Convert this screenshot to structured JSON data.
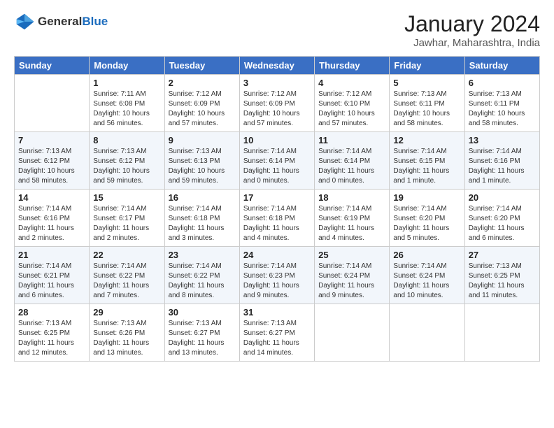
{
  "header": {
    "logo_general": "General",
    "logo_blue": "Blue",
    "month": "January 2024",
    "location": "Jawhar, Maharashtra, India"
  },
  "days_of_week": [
    "Sunday",
    "Monday",
    "Tuesday",
    "Wednesday",
    "Thursday",
    "Friday",
    "Saturday"
  ],
  "weeks": [
    [
      {
        "day": "",
        "info": ""
      },
      {
        "day": "1",
        "info": "Sunrise: 7:11 AM\nSunset: 6:08 PM\nDaylight: 10 hours\nand 56 minutes."
      },
      {
        "day": "2",
        "info": "Sunrise: 7:12 AM\nSunset: 6:09 PM\nDaylight: 10 hours\nand 57 minutes."
      },
      {
        "day": "3",
        "info": "Sunrise: 7:12 AM\nSunset: 6:09 PM\nDaylight: 10 hours\nand 57 minutes."
      },
      {
        "day": "4",
        "info": "Sunrise: 7:12 AM\nSunset: 6:10 PM\nDaylight: 10 hours\nand 57 minutes."
      },
      {
        "day": "5",
        "info": "Sunrise: 7:13 AM\nSunset: 6:11 PM\nDaylight: 10 hours\nand 58 minutes."
      },
      {
        "day": "6",
        "info": "Sunrise: 7:13 AM\nSunset: 6:11 PM\nDaylight: 10 hours\nand 58 minutes."
      }
    ],
    [
      {
        "day": "7",
        "info": "Sunrise: 7:13 AM\nSunset: 6:12 PM\nDaylight: 10 hours\nand 58 minutes."
      },
      {
        "day": "8",
        "info": "Sunrise: 7:13 AM\nSunset: 6:12 PM\nDaylight: 10 hours\nand 59 minutes."
      },
      {
        "day": "9",
        "info": "Sunrise: 7:13 AM\nSunset: 6:13 PM\nDaylight: 10 hours\nand 59 minutes."
      },
      {
        "day": "10",
        "info": "Sunrise: 7:14 AM\nSunset: 6:14 PM\nDaylight: 11 hours\nand 0 minutes."
      },
      {
        "day": "11",
        "info": "Sunrise: 7:14 AM\nSunset: 6:14 PM\nDaylight: 11 hours\nand 0 minutes."
      },
      {
        "day": "12",
        "info": "Sunrise: 7:14 AM\nSunset: 6:15 PM\nDaylight: 11 hours\nand 1 minute."
      },
      {
        "day": "13",
        "info": "Sunrise: 7:14 AM\nSunset: 6:16 PM\nDaylight: 11 hours\nand 1 minute."
      }
    ],
    [
      {
        "day": "14",
        "info": "Sunrise: 7:14 AM\nSunset: 6:16 PM\nDaylight: 11 hours\nand 2 minutes."
      },
      {
        "day": "15",
        "info": "Sunrise: 7:14 AM\nSunset: 6:17 PM\nDaylight: 11 hours\nand 2 minutes."
      },
      {
        "day": "16",
        "info": "Sunrise: 7:14 AM\nSunset: 6:18 PM\nDaylight: 11 hours\nand 3 minutes."
      },
      {
        "day": "17",
        "info": "Sunrise: 7:14 AM\nSunset: 6:18 PM\nDaylight: 11 hours\nand 4 minutes."
      },
      {
        "day": "18",
        "info": "Sunrise: 7:14 AM\nSunset: 6:19 PM\nDaylight: 11 hours\nand 4 minutes."
      },
      {
        "day": "19",
        "info": "Sunrise: 7:14 AM\nSunset: 6:20 PM\nDaylight: 11 hours\nand 5 minutes."
      },
      {
        "day": "20",
        "info": "Sunrise: 7:14 AM\nSunset: 6:20 PM\nDaylight: 11 hours\nand 6 minutes."
      }
    ],
    [
      {
        "day": "21",
        "info": "Sunrise: 7:14 AM\nSunset: 6:21 PM\nDaylight: 11 hours\nand 6 minutes."
      },
      {
        "day": "22",
        "info": "Sunrise: 7:14 AM\nSunset: 6:22 PM\nDaylight: 11 hours\nand 7 minutes."
      },
      {
        "day": "23",
        "info": "Sunrise: 7:14 AM\nSunset: 6:22 PM\nDaylight: 11 hours\nand 8 minutes."
      },
      {
        "day": "24",
        "info": "Sunrise: 7:14 AM\nSunset: 6:23 PM\nDaylight: 11 hours\nand 9 minutes."
      },
      {
        "day": "25",
        "info": "Sunrise: 7:14 AM\nSunset: 6:24 PM\nDaylight: 11 hours\nand 9 minutes."
      },
      {
        "day": "26",
        "info": "Sunrise: 7:14 AM\nSunset: 6:24 PM\nDaylight: 11 hours\nand 10 minutes."
      },
      {
        "day": "27",
        "info": "Sunrise: 7:13 AM\nSunset: 6:25 PM\nDaylight: 11 hours\nand 11 minutes."
      }
    ],
    [
      {
        "day": "28",
        "info": "Sunrise: 7:13 AM\nSunset: 6:25 PM\nDaylight: 11 hours\nand 12 minutes."
      },
      {
        "day": "29",
        "info": "Sunrise: 7:13 AM\nSunset: 6:26 PM\nDaylight: 11 hours\nand 13 minutes."
      },
      {
        "day": "30",
        "info": "Sunrise: 7:13 AM\nSunset: 6:27 PM\nDaylight: 11 hours\nand 13 minutes."
      },
      {
        "day": "31",
        "info": "Sunrise: 7:13 AM\nSunset: 6:27 PM\nDaylight: 11 hours\nand 14 minutes."
      },
      {
        "day": "",
        "info": ""
      },
      {
        "day": "",
        "info": ""
      },
      {
        "day": "",
        "info": ""
      }
    ]
  ]
}
